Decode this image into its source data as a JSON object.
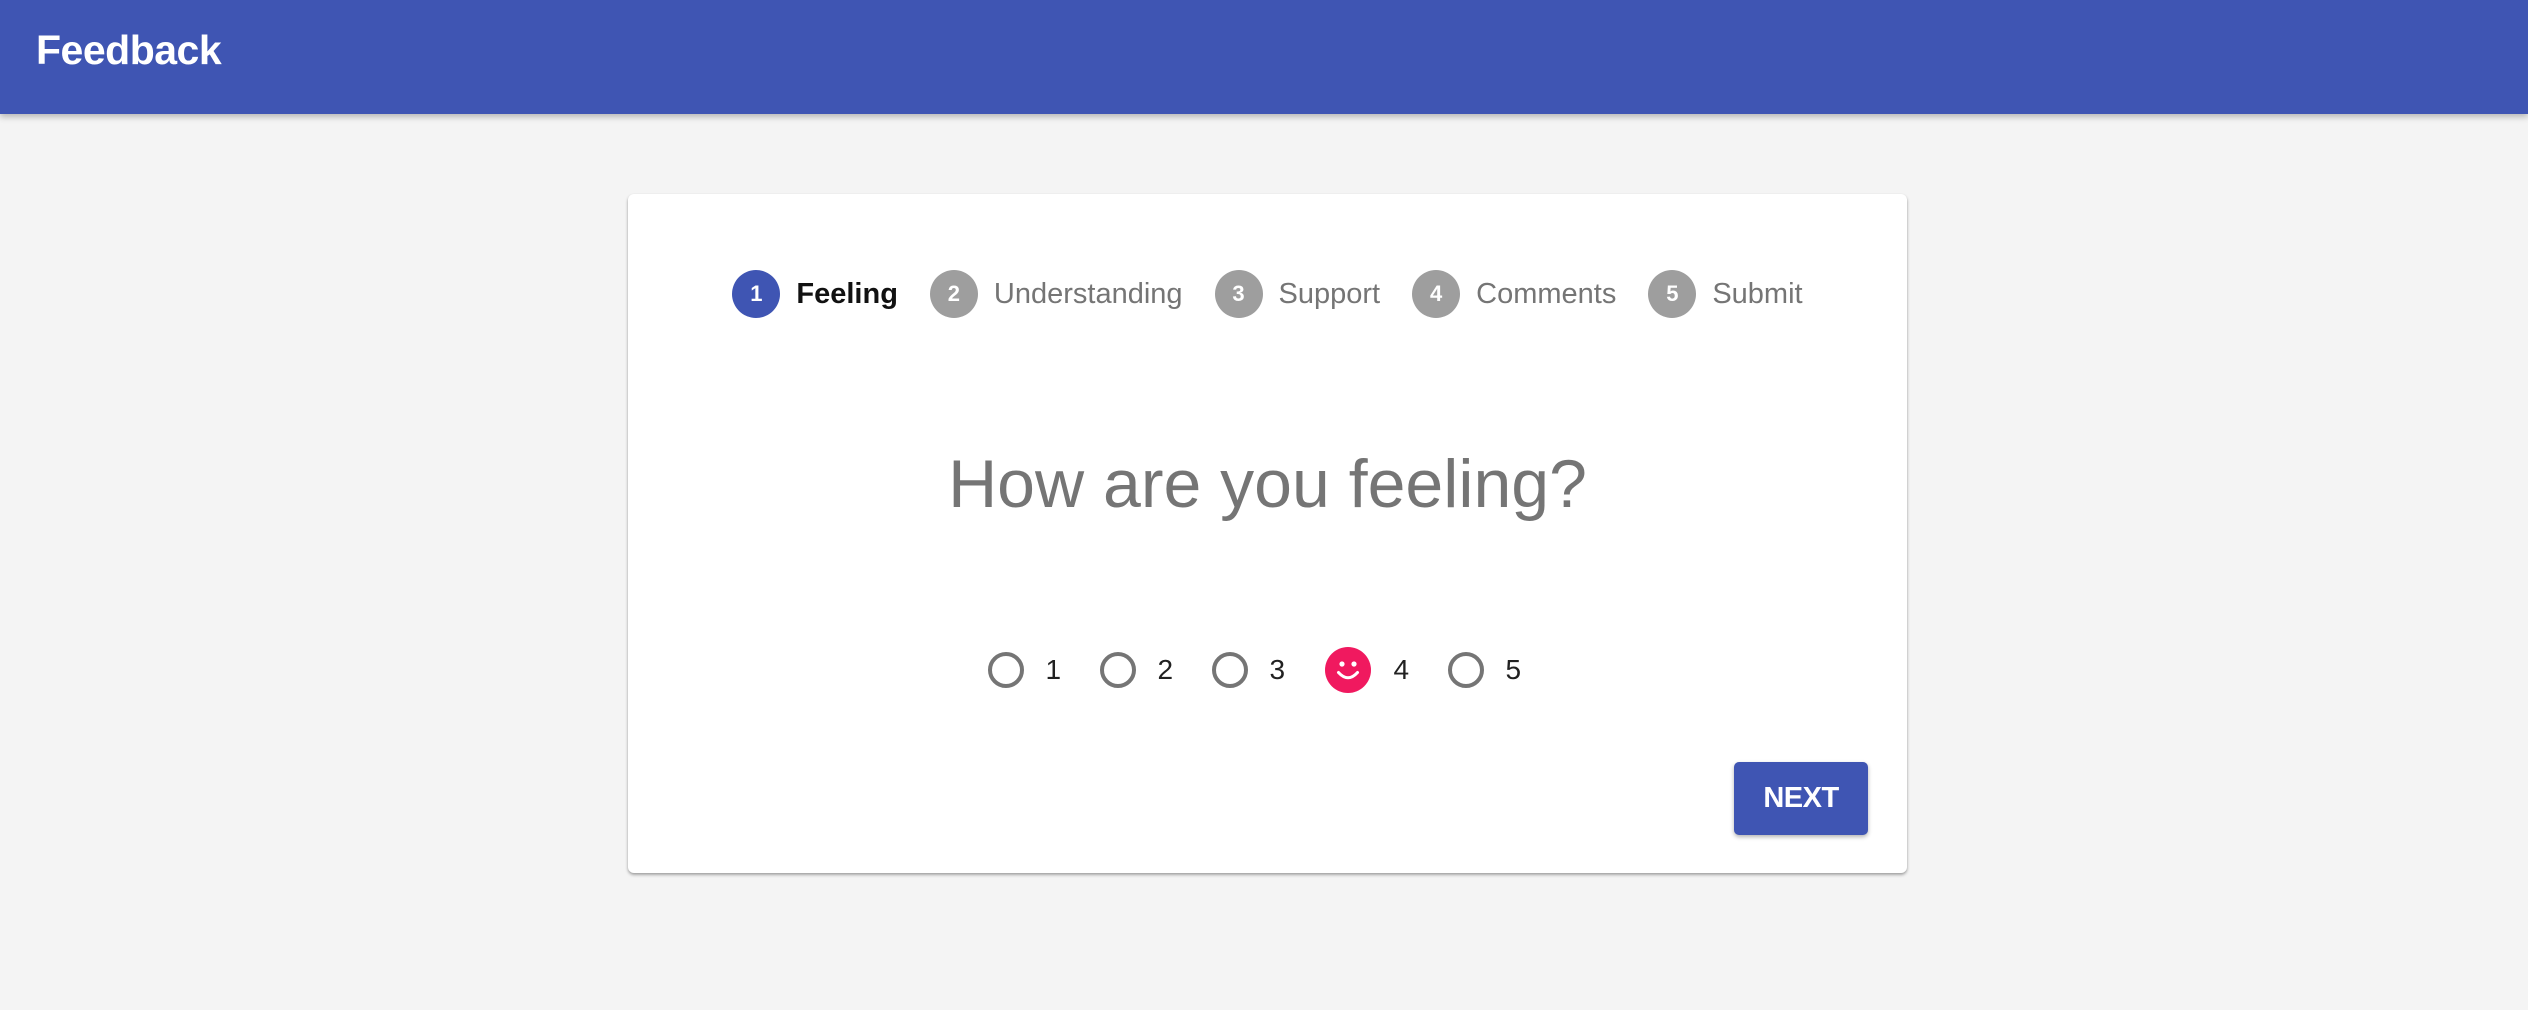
{
  "app": {
    "title": "Feedback"
  },
  "stepper": {
    "steps": [
      {
        "number": "1",
        "label": "Feeling",
        "active": true
      },
      {
        "number": "2",
        "label": "Understanding",
        "active": false
      },
      {
        "number": "3",
        "label": "Support",
        "active": false
      },
      {
        "number": "4",
        "label": "Comments",
        "active": false
      },
      {
        "number": "5",
        "label": "Submit",
        "active": false
      }
    ]
  },
  "question": {
    "text": "How are you feeling?"
  },
  "rating": {
    "options": [
      "1",
      "2",
      "3",
      "4",
      "5"
    ],
    "selected": "4",
    "selected_icon": "smiley-face-icon"
  },
  "actions": {
    "next_label": "NEXT"
  },
  "colors": {
    "primary": "#3f55b3",
    "accent": "#f0195f",
    "inactive_step": "#9e9e9e",
    "background": "#f4f4f4"
  }
}
